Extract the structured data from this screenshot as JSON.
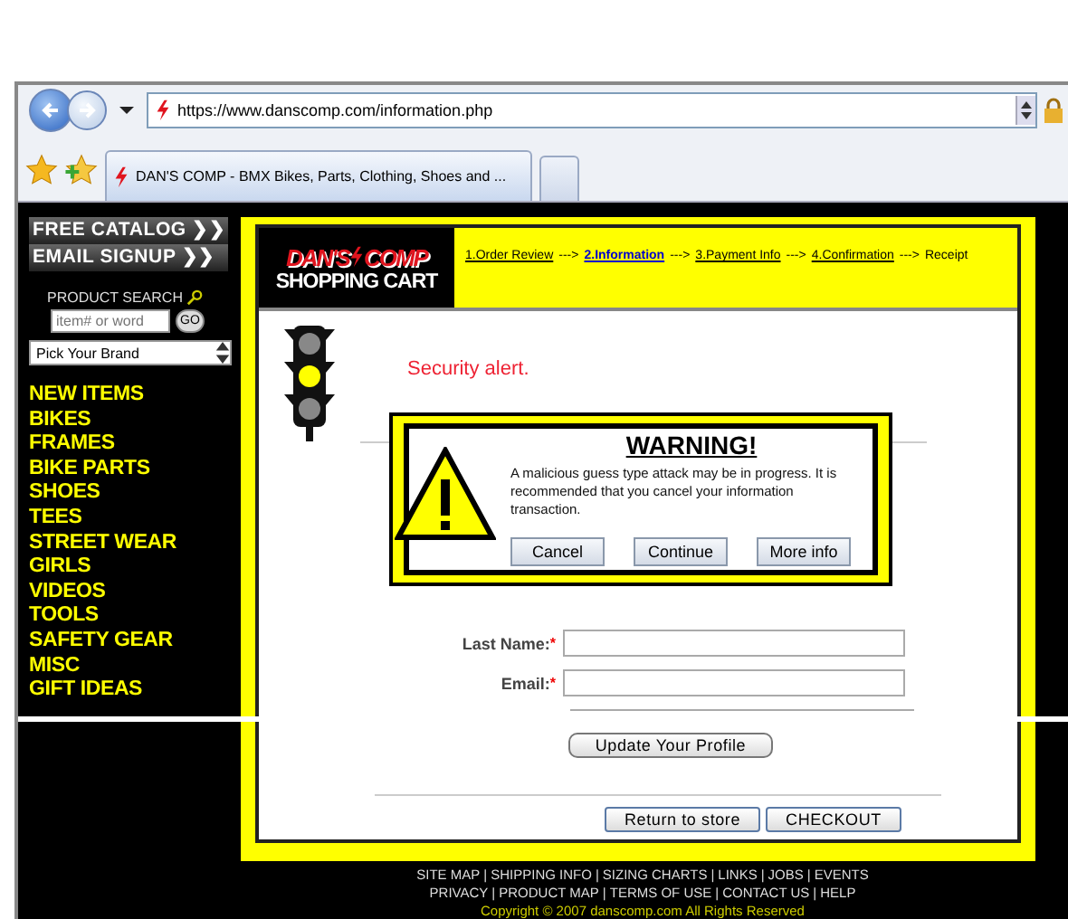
{
  "browser": {
    "address": "https://www.danscomp.com/information.php",
    "tab_title": "DAN'S COMP - BMX Bikes, Parts, Clothing, Shoes and ..."
  },
  "sidebar": {
    "promos": [
      "FREE CATALOG ❯❯",
      "EMAIL SIGNUP ❯❯"
    ],
    "search_label": "PRODUCT SEARCH",
    "search_placeholder": "item# or word",
    "go": "GO",
    "brand_select": "Pick Your Brand",
    "categories": [
      "NEW ITEMS",
      "BIKES",
      "FRAMES",
      "BIKE PARTS",
      "SHOES",
      "TEES",
      "STREET WEAR",
      "GIRLS",
      "VIDEOS",
      "TOOLS",
      "SAFETY GEAR",
      "MISC",
      "GIFT IDEAS"
    ]
  },
  "header": {
    "logo_left": "DAN'S",
    "logo_right": "COMP",
    "title": "SHOPPING CART",
    "steps": [
      {
        "label": "1.Order Review",
        "selected": false,
        "arrow": "--->"
      },
      {
        "label": "2.Information",
        "selected": true,
        "arrow": "--->"
      },
      {
        "label": "3.Payment Info",
        "selected": false,
        "arrow": "--->"
      },
      {
        "label": "4.Confirmation",
        "selected": false,
        "arrow": "--->"
      },
      {
        "label": "Receipt",
        "selected": false
      }
    ]
  },
  "alert": "Security alert.",
  "fields": [
    {
      "label": "Last Name:",
      "required": "*"
    },
    {
      "label": "Email:",
      "required": "*"
    }
  ],
  "update_button": "Update Your Profile",
  "actions": [
    "Return to store",
    "CHECKOUT"
  ],
  "dialog": {
    "title": "WARNING!",
    "message": "A malicious guess type attack may be in progress. It is recommended that you cancel your information transaction.",
    "buttons": [
      "Cancel",
      "Continue",
      "More info"
    ]
  },
  "footer": {
    "separator": "|",
    "lines": [
      [
        "SITE MAP",
        "SHIPPING INFO",
        "SIZING CHARTS",
        "LINKS",
        "JOBS",
        "EVENTS"
      ],
      [
        "PRIVACY",
        "PRODUCT MAP",
        "TERMS OF USE",
        "CONTACT US",
        "HELP"
      ]
    ],
    "copyright": "Copyright © 2007 danscomp.com All Rights Reserved"
  }
}
